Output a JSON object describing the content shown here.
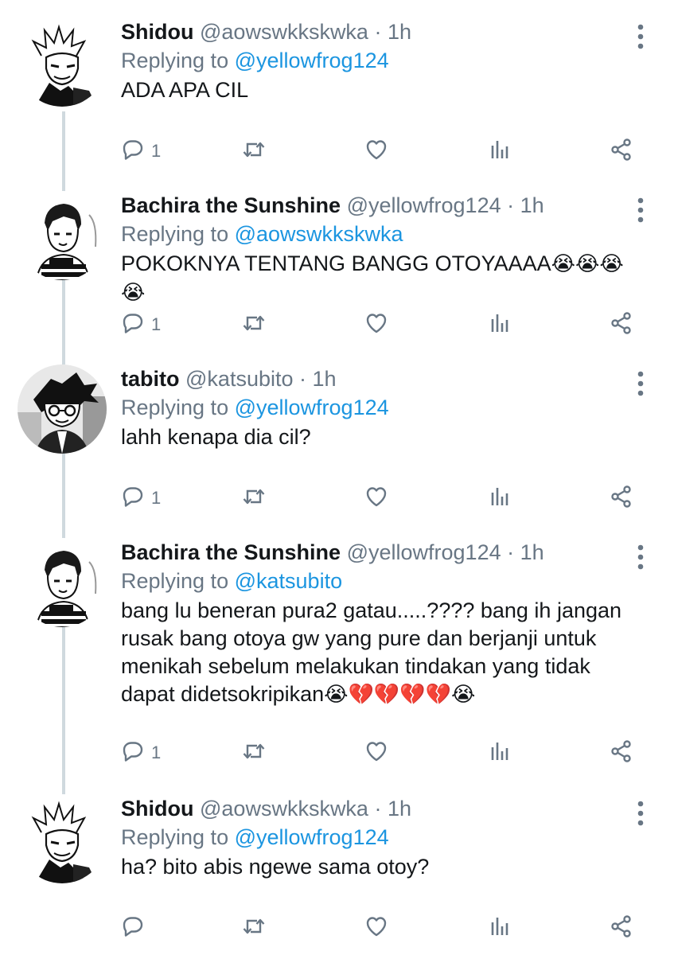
{
  "tweets": [
    {
      "name": "Shidou",
      "handle": "@aowswkkskwka",
      "dot": "·",
      "time": "1h",
      "replying_prefix": "Replying to",
      "replying_to": "@yellowfrog124",
      "text": "ADA APA CIL",
      "emojis": "",
      "reply_count": "1",
      "avatar": "shidou-avatar"
    },
    {
      "name": "Bachira the Sunshine",
      "handle": "@yellowfrog124",
      "dot": "·",
      "time": "1h",
      "replying_prefix": "Replying to",
      "replying_to": "@aowswkkskwka",
      "text": "POKOKNYA TENTANG BANGG OTOYAAAA",
      "emojis": "😭😭😭😭",
      "reply_count": "1",
      "avatar": "bachira-avatar"
    },
    {
      "name": "tabito",
      "handle": "@katsubito",
      "dot": "·",
      "time": "1h",
      "replying_prefix": "Replying to",
      "replying_to": "@yellowfrog124",
      "text": "lahh kenapa dia cil?",
      "emojis": "",
      "reply_count": "1",
      "avatar": "tabito-avatar"
    },
    {
      "name": "Bachira the Sunshine",
      "handle": "@yellowfrog124",
      "dot": "·",
      "time": "1h",
      "replying_prefix": "Replying to",
      "replying_to": "@katsubito",
      "text": "bang lu beneran pura2 gatau.....???? bang ih jangan rusak bang otoya gw yang pure dan berjanji untuk menikah sebelum melakukan tindakan yang tidak dapat didetsokripikan",
      "emojis": "😭💔💔💔💔😭",
      "reply_count": "1",
      "avatar": "bachira-avatar"
    },
    {
      "name": "Shidou",
      "handle": "@aowswkkskwka",
      "dot": "·",
      "time": "1h",
      "replying_prefix": "Replying to",
      "replying_to": "@yellowfrog124",
      "text": "ha? bito abis ngewe sama otoy?",
      "emojis": "",
      "reply_count": "",
      "avatar": "shidou-avatar"
    }
  ],
  "icons": {
    "reply": "reply-icon",
    "retweet": "retweet-icon",
    "like": "heart-icon",
    "analytics": "analytics-icon",
    "share": "share-icon",
    "more": "more-options-icon"
  },
  "colors": {
    "name": "#14171a",
    "secondary": "#687684",
    "link": "#1b95e0",
    "thread_line": "#cfd9de"
  }
}
